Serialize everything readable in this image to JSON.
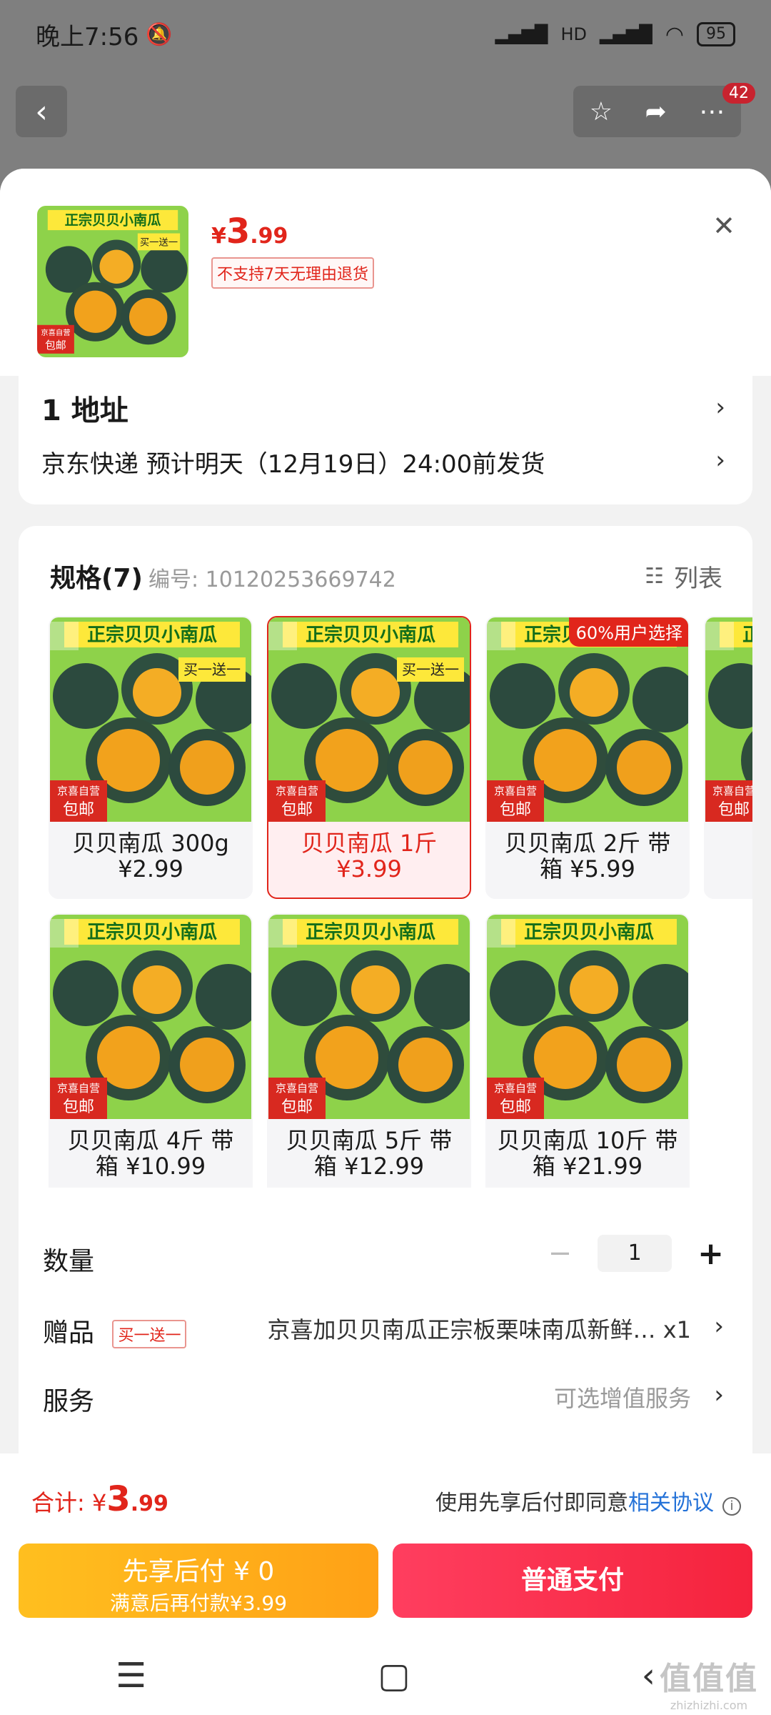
{
  "status": {
    "time": "晚上7:56",
    "battery": "95",
    "net": "HD"
  },
  "topbar": {
    "badge": "42"
  },
  "header": {
    "price_symbol": "¥",
    "price_int": "3",
    "price_dec": ".99",
    "return_policy": "不支持7天无理由退货"
  },
  "thumb_image": {
    "title": "正宗贝贝小南瓜",
    "promo": "买一送一",
    "seller": "京喜自营",
    "shipping": "包邮"
  },
  "address": {
    "title": "1 地址",
    "shipping": "京东快递 预计明天（12月19日）24:00前发货"
  },
  "spec": {
    "title": "规格(7)",
    "code": "编号: 10120253669742",
    "list_label": "列表"
  },
  "variants": [
    {
      "label": "贝贝南瓜 300g ¥2.99",
      "selected": false,
      "promo": "买一送一"
    },
    {
      "label": "贝贝南瓜 1斤 ¥3.99",
      "selected": true,
      "promo": "买一送一"
    },
    {
      "label": "贝贝南瓜 2斤 带箱 ¥5.99",
      "selected": false,
      "badge": "60%用户选择"
    },
    {
      "label": "贝",
      "selected": false
    },
    {
      "label": "贝贝南瓜 4斤 带箱 ¥10.99",
      "selected": false
    },
    {
      "label": "贝贝南瓜 5斤 带箱 ¥12.99",
      "selected": false
    },
    {
      "label": "贝贝南瓜 10斤 带箱 ¥21.99",
      "selected": false
    }
  ],
  "quantity": {
    "label": "数量",
    "value": "1"
  },
  "gift": {
    "label": "赠品",
    "tag": "买一送一",
    "text": "京喜加贝贝南瓜正宗板栗味南瓜新鲜… x1"
  },
  "service": {
    "label": "服务",
    "text": "可选增值服务"
  },
  "footer": {
    "total_label": "合计: ¥",
    "total_int": "3",
    "total_dec": ".99",
    "agree_prefix": "使用先享后付即同意",
    "agree_link": "相关协议"
  },
  "buttons": {
    "later_l1": "先享后付 ¥ 0",
    "later_l2": "满意后再付款¥3.99",
    "pay": "普通支付"
  },
  "watermark": {
    "line1": "值值值",
    "line2": "zhizhizhi.com"
  }
}
